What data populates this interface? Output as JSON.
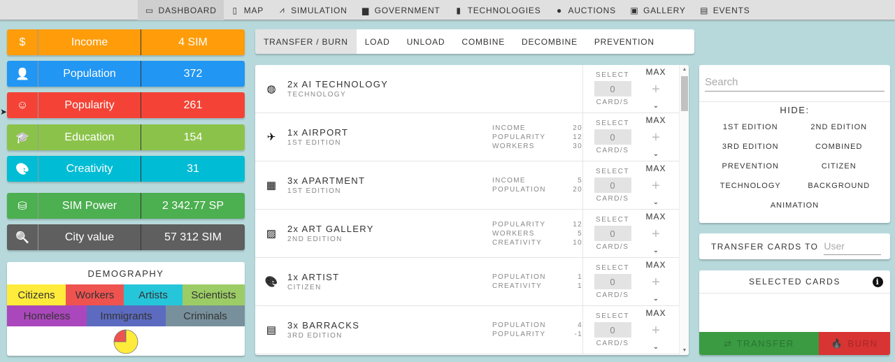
{
  "nav": {
    "items": [
      {
        "label": "DASHBOARD",
        "icon": "laptop-icon",
        "glyph": "▭",
        "active": true
      },
      {
        "label": "MAP",
        "icon": "tablet-icon",
        "glyph": "▯",
        "active": false
      },
      {
        "label": "SIMULATION",
        "icon": "compass-icon",
        "glyph": "⩘",
        "active": false
      },
      {
        "label": "GOVERNMENT",
        "icon": "government-icon",
        "glyph": "▆",
        "active": false
      },
      {
        "label": "TECHNOLOGIES",
        "icon": "microchip-icon",
        "glyph": "▮",
        "active": false
      },
      {
        "label": "AUCTIONS",
        "icon": "coin-icon",
        "glyph": "●",
        "active": false
      },
      {
        "label": "GALLERY",
        "icon": "images-icon",
        "glyph": "▣",
        "active": false
      },
      {
        "label": "EVENTS",
        "icon": "calendar-icon",
        "glyph": "▤",
        "active": false
      }
    ]
  },
  "stats": [
    {
      "label": "Income",
      "value": "4 SIM",
      "icon": "dollar-icon",
      "glyph": "$",
      "color": "#ff9c0a"
    },
    {
      "label": "Population",
      "value": "372",
      "icon": "user-icon",
      "glyph": "👤",
      "color": "#2196f3"
    },
    {
      "label": "Popularity",
      "value": "261",
      "icon": "smile-icon",
      "glyph": "☺",
      "color": "#f44336"
    },
    {
      "label": "Education",
      "value": "154",
      "icon": "graduation-cap-icon",
      "glyph": "🎓",
      "color": "#8bc34a"
    },
    {
      "label": "Creativity",
      "value": "31",
      "icon": "palette-icon",
      "glyph": "🎨",
      "color": "#00bcd4"
    },
    {
      "label": "SIM Power",
      "value": "2 342.77 SP",
      "icon": "coins-icon",
      "glyph": "⛁",
      "color": "#4caf50"
    },
    {
      "label": "City value",
      "value": "57 312 SIM",
      "icon": "search-dollar-icon",
      "glyph": "🔍",
      "color": "#5f5f5f"
    }
  ],
  "demography": {
    "title": "DEMOGRAPHY",
    "row1": [
      {
        "label": "Citizens",
        "color": "#ffeb3b"
      },
      {
        "label": "Workers",
        "color": "#ef5350"
      },
      {
        "label": "Artists",
        "color": "#26c6da"
      },
      {
        "label": "Scientists",
        "color": "#9ccc65"
      }
    ],
    "row2": [
      {
        "label": "Homeless",
        "color": "#ab47bc"
      },
      {
        "label": "Immigrants",
        "color": "#5c6bc0"
      },
      {
        "label": "Criminals",
        "color": "#78909c"
      }
    ],
    "pie": [
      {
        "label": "Citizens",
        "fraction": 0.75,
        "color": "#ffeb3b"
      },
      {
        "label": "Workers",
        "fraction": 0.24,
        "color": "#ef5350"
      },
      {
        "label": "Criminals",
        "fraction": 0.01,
        "color": "#78909c"
      }
    ]
  },
  "tabs": [
    {
      "label": "TRANSFER / BURN",
      "active": true
    },
    {
      "label": "LOAD",
      "active": false
    },
    {
      "label": "UNLOAD",
      "active": false
    },
    {
      "label": "COMBINE",
      "active": false
    },
    {
      "label": "DECOMBINE",
      "active": false
    },
    {
      "label": "PREVENTION",
      "active": false
    }
  ],
  "card_controls": {
    "select_label": "SELECT",
    "cards_label": "CARD/S",
    "max_label": "MAX",
    "plus": "+",
    "chevron": "⌄"
  },
  "cards": [
    {
      "title": "2x AI TECHNOLOGY",
      "sub": "TECHNOLOGY",
      "icon": "brain-icon",
      "glyph": "◍",
      "select_value": "0",
      "stats": []
    },
    {
      "title": "1x AIRPORT",
      "sub": "1ST EDITION",
      "icon": "plane-icon",
      "glyph": "✈",
      "select_value": "0",
      "stats": [
        {
          "k": "INCOME",
          "v": "20"
        },
        {
          "k": "POPULARITY",
          "v": "12"
        },
        {
          "k": "WORKERS",
          "v": "30"
        }
      ]
    },
    {
      "title": "3x APARTMENT",
      "sub": "1ST EDITION",
      "icon": "building-icon",
      "glyph": "▦",
      "select_value": "0",
      "stats": [
        {
          "k": "INCOME",
          "v": "5"
        },
        {
          "k": "POPULATION",
          "v": "20"
        }
      ]
    },
    {
      "title": "2x ART GALLERY",
      "sub": "2ND EDITION",
      "icon": "image-icon",
      "glyph": "▨",
      "select_value": "0",
      "stats": [
        {
          "k": "POPULARITY",
          "v": "12"
        },
        {
          "k": "WORKERS",
          "v": "5"
        },
        {
          "k": "CREATIVITY",
          "v": "10"
        }
      ]
    },
    {
      "title": "1x ARTIST",
      "sub": "CITIZEN",
      "icon": "palette-icon",
      "glyph": "🎨",
      "select_value": "0",
      "stats": [
        {
          "k": "POPULATION",
          "v": "1"
        },
        {
          "k": "CREATIVITY",
          "v": "1"
        }
      ]
    },
    {
      "title": "3x BARRACKS",
      "sub": "3RD EDITION",
      "icon": "clipboard-icon",
      "glyph": "▤",
      "select_value": "0",
      "stats": [
        {
          "k": "POPULATION",
          "v": "4"
        },
        {
          "k": "POPULARITY",
          "v": "-1"
        }
      ]
    }
  ],
  "filter": {
    "search_placeholder": "Search",
    "hide_title": "HIDE:",
    "options": [
      "1ST EDITION",
      "2ND EDITION",
      "3RD EDITION",
      "COMBINED",
      "PREVENTION",
      "CITIZEN",
      "TECHNOLOGY",
      "BACKGROUND",
      "ANIMATION"
    ]
  },
  "transfer_to": {
    "label": "TRANSFER CARDS TO",
    "placeholder": "User"
  },
  "selected_cards": {
    "title": "SELECTED CARDS",
    "info_glyph": "i",
    "transfer_label": "TRANSFER",
    "transfer_glyph": "⇄",
    "burn_label": "BURN",
    "burn_glyph": "🔥"
  }
}
